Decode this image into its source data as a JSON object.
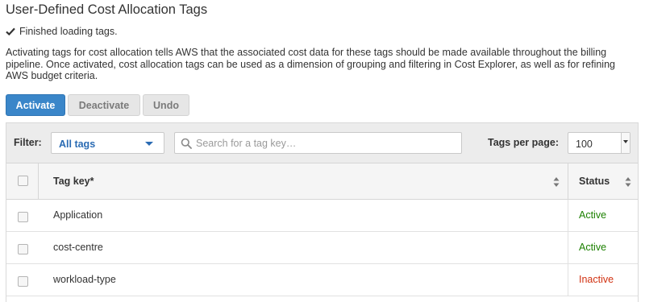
{
  "page": {
    "title": "User-Defined Cost Allocation Tags",
    "status_message": "Finished loading tags.",
    "description": "Activating tags for cost allocation tells AWS that the associated cost data for these tags should be made available throughout the billing pipeline. Once activated, cost allocation tags can be used as a dimension of grouping and filtering in Cost Explorer, as well as for refining AWS budget criteria."
  },
  "actions": {
    "activate": "Activate",
    "deactivate": "Deactivate",
    "undo": "Undo"
  },
  "filter": {
    "label": "Filter:",
    "selected": "All tags",
    "search_placeholder": "Search for a tag key…",
    "per_page_label": "Tags per page:",
    "per_page_value": "100"
  },
  "table": {
    "columns": {
      "tag_key": "Tag key*",
      "status": "Status"
    },
    "rows": [
      {
        "key": "Application",
        "status": "Active"
      },
      {
        "key": "cost-centre",
        "status": "Active"
      },
      {
        "key": "workload-type",
        "status": "Inactive"
      }
    ]
  },
  "colors": {
    "accent": "#3a86c9",
    "active": "#1d8102",
    "inactive": "#d13212",
    "link": "#2a6bb3"
  },
  "icons": {
    "status": "check-icon",
    "search": "search-icon",
    "filter_dropdown": "caret-down-icon",
    "sort": "sort-icon"
  }
}
